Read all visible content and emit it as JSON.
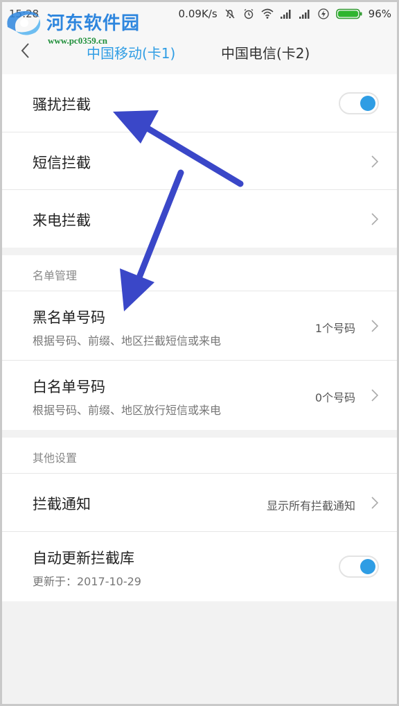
{
  "status_bar": {
    "time": "15:28",
    "speed": "0.09K/s",
    "battery": "96%",
    "icons": [
      "mute-icon",
      "alarm-icon",
      "wifi-icon",
      "signal-icon",
      "signal-icon",
      "charging-icon",
      "battery-icon"
    ]
  },
  "watermark": {
    "title": "河东软件园",
    "url": "www.pc0359.cn"
  },
  "header": {
    "tab_sim1": "中国移动(卡1)",
    "tab_sim2": "中国电信(卡2)",
    "active_color": "#2f9de4"
  },
  "main": {
    "harass_block": {
      "label": "骚扰拦截",
      "enabled": true
    },
    "sms_block": {
      "label": "短信拦截"
    },
    "call_block": {
      "label": "来电拦截"
    }
  },
  "list_management": {
    "header": "名单管理",
    "blacklist": {
      "title": "黑名单号码",
      "subtitle": "根据号码、前缀、地区拦截短信或来电",
      "count": "1个号码"
    },
    "whitelist": {
      "title": "白名单号码",
      "subtitle": "根据号码、前缀、地区放行短信或来电",
      "count": "0个号码"
    }
  },
  "other_settings": {
    "header": "其他设置",
    "notification": {
      "title": "拦截通知",
      "value": "显示所有拦截通知"
    },
    "auto_update": {
      "title": "自动更新拦截库",
      "subtitle": "更新于：2017-10-29",
      "enabled": true
    }
  },
  "colors": {
    "accent": "#2f9de4",
    "annotation_arrow": "#3a47c8"
  }
}
